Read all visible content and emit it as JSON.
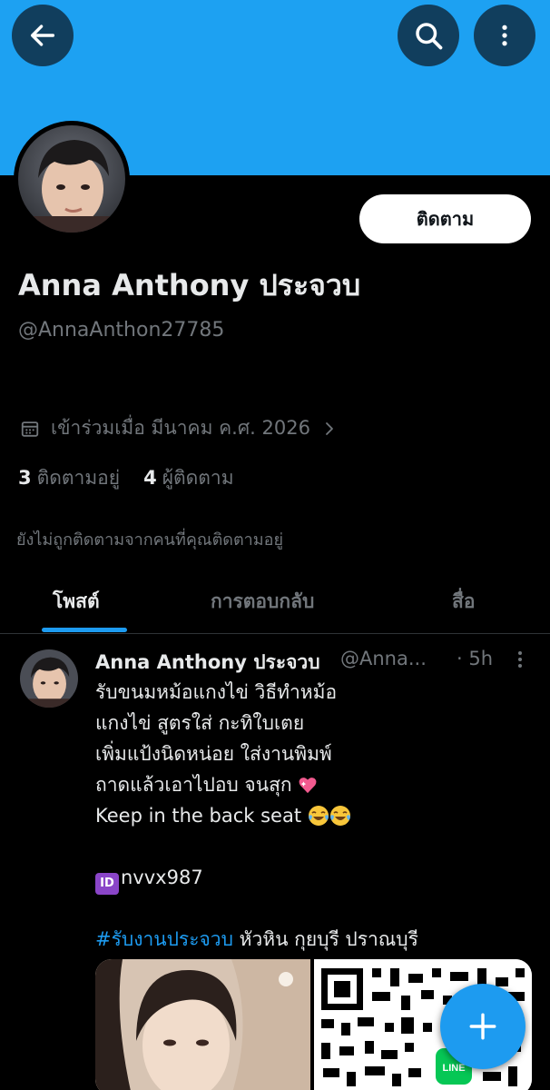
{
  "header": {
    "back_icon": "arrow-left-icon",
    "search_icon": "search-icon",
    "more_icon": "more-vertical-icon",
    "banner_color": "#1da1f2"
  },
  "profile": {
    "follow_label": "ติดตาม",
    "display_name": "Anna Anthony ประจวบ",
    "handle": "@AnnaAnthon27785",
    "joined": "เข้าร่วมเมื่อ มีนาคม ค.ศ. 2026",
    "following_count": "3",
    "following_label": "ติดตามอยู่",
    "followers_count": "4",
    "followers_label": "ผู้ติดตาม",
    "not_followed_note": "ยังไม่ถูกติดตามจากคนที่คุณติดตามอยู่"
  },
  "tabs": [
    {
      "label": "โพสต์",
      "active": true
    },
    {
      "label": "การตอบกลับ",
      "active": false
    },
    {
      "label": "สื่อ",
      "active": false
    }
  ],
  "post": {
    "name": "Anna Anthony ประจวบ",
    "handle": "@Anna...",
    "time": "· 5h",
    "lines": [
      "รับขนมหม้อแกงไข่ วิธีทำหม้อ",
      "แกงไข่ สูตรใส่ กะทิใบเตย",
      "เพิ่มแป้งนิดหน่อย ใส่งานพิมพ์",
      "ถาดแล้วเอาไปอบ จนสุก",
      "Keep in the back seat"
    ],
    "id_badge": "ID",
    "id_text": "nvvx987",
    "hashtag": "#รับงานประจวบ",
    "locations": " หัวหิน กุยบุรี ปราณบุรี",
    "qr_badge": "LINE"
  },
  "fab": {
    "icon": "plus-icon",
    "color": "#1d9bf0"
  }
}
